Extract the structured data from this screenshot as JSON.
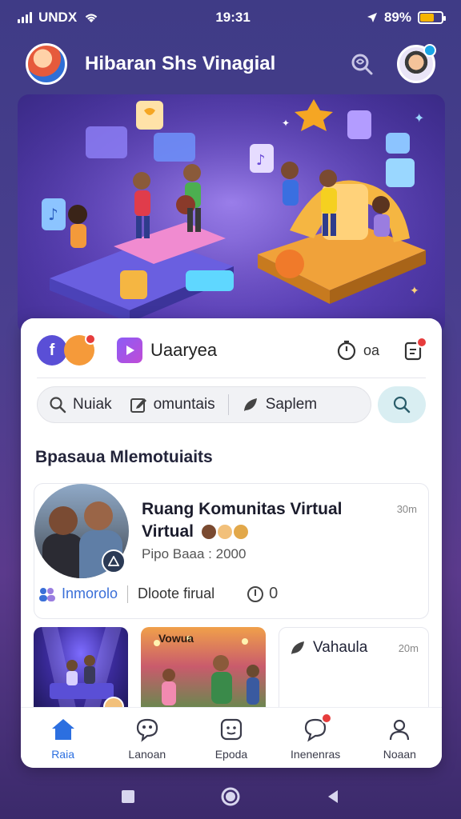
{
  "status_bar": {
    "carrier": "UNDX",
    "time": "19:31",
    "battery_percent": "89%",
    "battery_level": 0.65
  },
  "header": {
    "title": "Hibaran Shs Vinagial",
    "logo_icon": "app-logo-avatar",
    "action_icon": "heart-search-icon",
    "profile_icon": "user-avatar"
  },
  "hero": {
    "icon": "virtual-community-illustration"
  },
  "app_bar": {
    "label": "Uaaryea",
    "timer_text": "oa",
    "notification_icon": "notification-icon"
  },
  "search": {
    "segments": [
      {
        "icon": "search-icon",
        "label": "Nuiak"
      },
      {
        "icon": "edit-icon",
        "label": "omuntais"
      },
      {
        "icon": "leaf-icon",
        "label": "Saplem"
      }
    ],
    "button_icon": "search-icon"
  },
  "section_title": "Bpasaua Mlemotuiaits",
  "community": {
    "title": "Ruang Komunitas Virtual Virtual",
    "time": "30m",
    "meta": "Pipo Baaa : 2000",
    "link_label": "Inmorolo",
    "footer_text": "Dloote firual",
    "count": "0"
  },
  "media": {
    "party_caption": "Vowua",
    "post_label": "Vahaula",
    "post_time": "20m"
  },
  "bottom_nav": [
    {
      "label": "Raia",
      "icon": "home-icon",
      "active": true
    },
    {
      "label": "Lanoan",
      "icon": "chat-face-icon",
      "active": false
    },
    {
      "label": "Epoda",
      "icon": "smile-square-icon",
      "active": false
    },
    {
      "label": "Inenenras",
      "icon": "message-icon",
      "active": false
    },
    {
      "label": "Noaan",
      "icon": "profile-icon",
      "active": false
    }
  ],
  "colors": {
    "accent": "#2c6fe0",
    "background": "#433c88",
    "badge": "#e63c3c"
  }
}
